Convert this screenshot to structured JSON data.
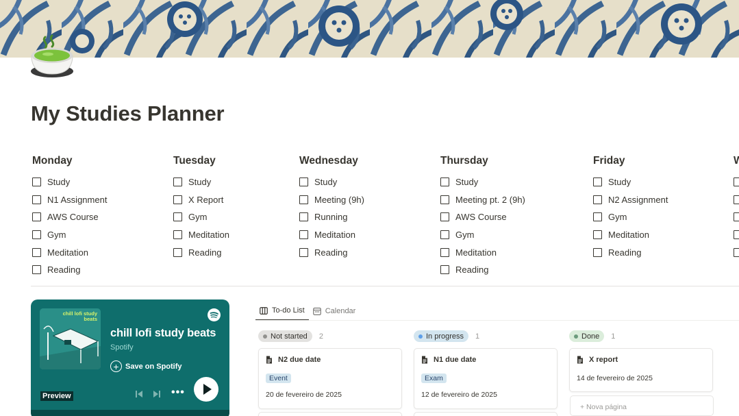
{
  "page": {
    "title": "My Studies Planner",
    "icon": "matcha-tea-bowl-icon"
  },
  "days": [
    {
      "name": "Monday",
      "tasks": [
        "Study",
        "N1 Assignment",
        "AWS Course",
        "Gym",
        "Meditation",
        "Reading"
      ]
    },
    {
      "name": "Tuesday",
      "tasks": [
        "Study",
        "X Report",
        "Gym",
        "Meditation",
        "Reading"
      ]
    },
    {
      "name": "Wednesday",
      "tasks": [
        "Study",
        "Meeting (9h)",
        "Running",
        "Meditation",
        "Reading"
      ]
    },
    {
      "name": "Thursday",
      "tasks": [
        "Study",
        "Meeting pt. 2 (9h)",
        "AWS Course",
        "Gym",
        "Meditation",
        "Reading"
      ]
    },
    {
      "name": "Friday",
      "tasks": [
        "Study",
        "N2 Assignment",
        "Gym",
        "Meditation",
        "Reading"
      ]
    },
    {
      "name": "W",
      "tasks": [
        "",
        "",
        "",
        "",
        ""
      ]
    }
  ],
  "spotify": {
    "art_title": "chill lofi study beats",
    "title": "chill lofi study beats",
    "artist": "Spotify",
    "save_label": "Save on Spotify",
    "preview_label": "Preview",
    "more_label": "•••",
    "brand_color": "#0f6e6c"
  },
  "tabs": [
    {
      "label": "To-do List",
      "icon": "board-icon",
      "active": true
    },
    {
      "label": "Calendar",
      "icon": "calendar-icon",
      "active": false
    }
  ],
  "board": {
    "columns": [
      {
        "status": "Not started",
        "count": "2",
        "pill_color": "#e3e2e0",
        "dot_color": "#91918e",
        "cards": [
          {
            "title": "N2 due date",
            "tag": "Event",
            "date": "20 de fevereiro de 2025"
          }
        ]
      },
      {
        "status": "In progress",
        "count": "1",
        "pill_color": "#d3e5ef",
        "dot_color": "#5e9fe8",
        "cards": [
          {
            "title": "N1 due date",
            "tag": "Exam",
            "date": "12 de fevereiro de 2025"
          }
        ]
      },
      {
        "status": "Done",
        "count": "1",
        "pill_color": "#dbeddb",
        "dot_color": "#6c9b7d",
        "cards": [
          {
            "title": "X report",
            "tag": "",
            "date": "14 de fevereiro de 2025"
          }
        ]
      }
    ],
    "new_page_label": "+ Nova página"
  }
}
